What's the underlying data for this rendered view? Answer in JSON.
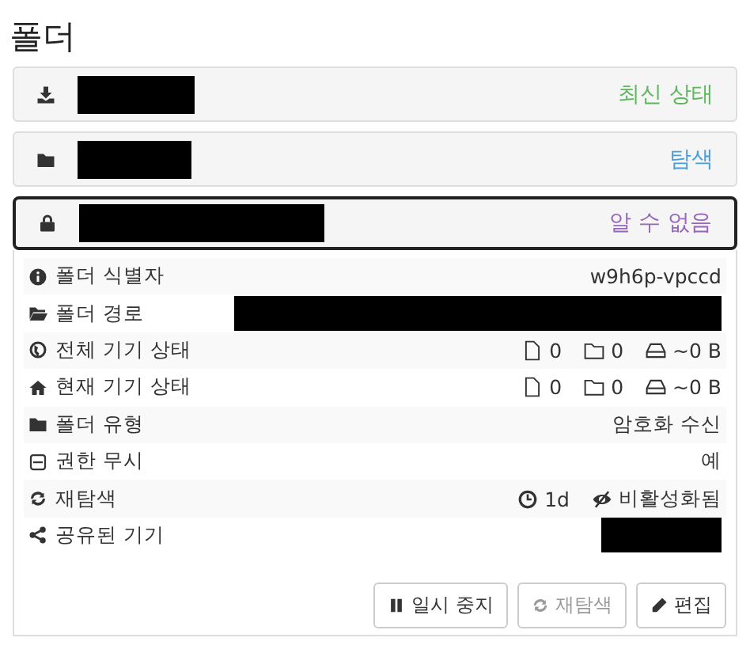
{
  "title": "폴더",
  "folders": [
    {
      "status": "최신 상태",
      "color": "#5cb85c",
      "selected": false
    },
    {
      "status": "탐색",
      "color": "#4a9fd8",
      "selected": false
    },
    {
      "status": "알 수 없음",
      "color": "#9966bb",
      "selected": true
    }
  ],
  "details": [
    {
      "label": "폴더 식별자",
      "kind": "text",
      "value": "w9h6p-vpccd"
    },
    {
      "label": "폴더 경로",
      "kind": "redacted"
    },
    {
      "label": "전체 기기 상태",
      "kind": "counts",
      "files": "0",
      "dirs": "0",
      "size": "~0 B"
    },
    {
      "label": "현재 기기 상태",
      "kind": "counts",
      "files": "0",
      "dirs": "0",
      "size": "~0 B"
    },
    {
      "label": "폴더 유형",
      "kind": "text",
      "value": "암호화 수신"
    },
    {
      "label": "권한 무시",
      "kind": "text",
      "value": "예"
    },
    {
      "label": "재탐색",
      "kind": "rescan",
      "interval": "1d",
      "watcher": "비활성화됨"
    },
    {
      "label": "공유된 기기",
      "kind": "redacted"
    }
  ],
  "buttons": [
    {
      "label": "일시 중지",
      "disabled": false
    },
    {
      "label": "재탐색",
      "disabled": true
    },
    {
      "label": "편집",
      "disabled": false
    }
  ]
}
